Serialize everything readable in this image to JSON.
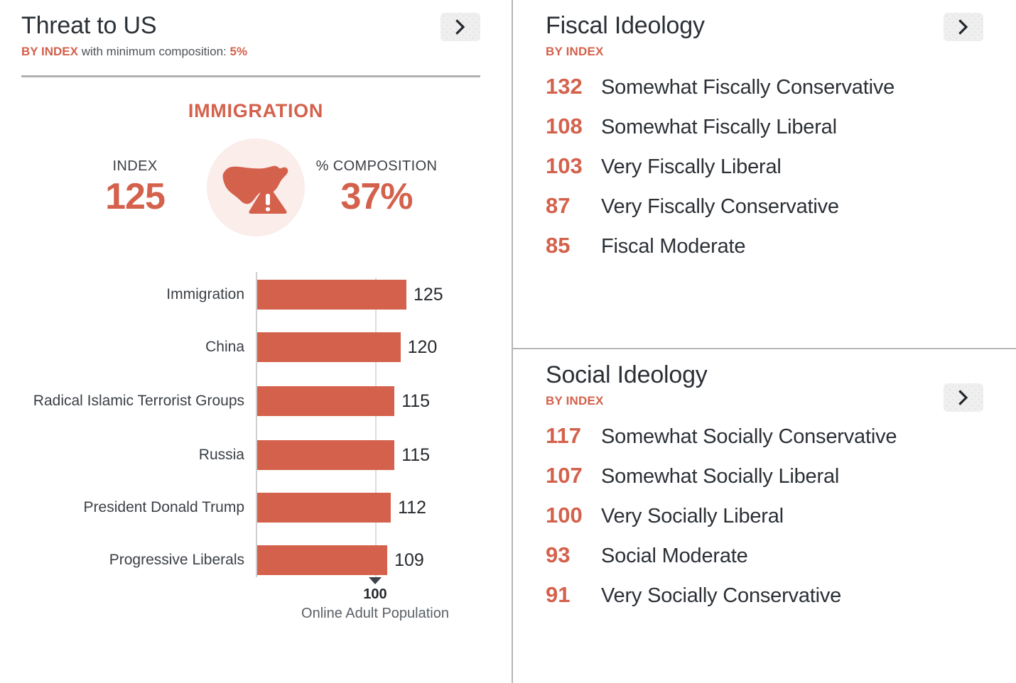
{
  "theme": {
    "accent": "#d4614c",
    "accent_light": "#faedea",
    "text_dark": "#2b3036",
    "divider": "#b5b5b5"
  },
  "threat_panel": {
    "title": "Threat to US",
    "sub_prefix": "BY INDEX",
    "sub_middle": " with minimum composition: ",
    "sub_value": "5%",
    "chevron_icon": "chevron-right-icon",
    "summary": {
      "title": "IMMIGRATION",
      "index_label": "INDEX",
      "index_value": "125",
      "composition_label": "% COMPOSITION",
      "composition_value": "37%",
      "icon": "us-map-warning-icon"
    },
    "chart_footer": {
      "marker_icon": "triangle-down-marker-icon",
      "tick_label": "100",
      "caption": "Online Adult Population"
    }
  },
  "chart_data": {
    "type": "bar",
    "orientation": "horizontal",
    "title": "Threat to US",
    "xlabel": "Online Adult Population",
    "ylabel": "",
    "categories": [
      "Immigration",
      "China",
      "Radical Islamic Terrorist Groups",
      "Russia",
      "President Donald Trump",
      "Progressive Liberals"
    ],
    "values": [
      125,
      120,
      115,
      115,
      112,
      109
    ],
    "value_labels": [
      "125",
      "120",
      "115",
      "115",
      "112",
      "109"
    ],
    "xlim": [
      0,
      125
    ],
    "reference_line": 100,
    "reference_line_label": "100",
    "grid": false,
    "legend": false,
    "series_color": "#d4614c"
  },
  "fiscal_panel": {
    "title": "Fiscal Ideology",
    "sub": "BY INDEX",
    "chevron_icon": "chevron-right-icon",
    "items": [
      {
        "value": "132",
        "label": "Somewhat Fiscally Conservative"
      },
      {
        "value": "108",
        "label": "Somewhat Fiscally Liberal"
      },
      {
        "value": "103",
        "label": "Very Fiscally Liberal"
      },
      {
        "value": "87",
        "label": "Very Fiscally Conservative"
      },
      {
        "value": "85",
        "label": "Fiscal Moderate"
      }
    ]
  },
  "social_panel": {
    "title": "Social Ideology",
    "sub": "BY INDEX",
    "chevron_icon": "chevron-right-icon",
    "items": [
      {
        "value": "117",
        "label": "Somewhat Socially Conservative"
      },
      {
        "value": "107",
        "label": "Somewhat Socially Liberal"
      },
      {
        "value": "100",
        "label": "Very Socially Liberal"
      },
      {
        "value": "93",
        "label": "Social Moderate"
      },
      {
        "value": "91",
        "label": "Very Socially Conservative"
      }
    ]
  }
}
